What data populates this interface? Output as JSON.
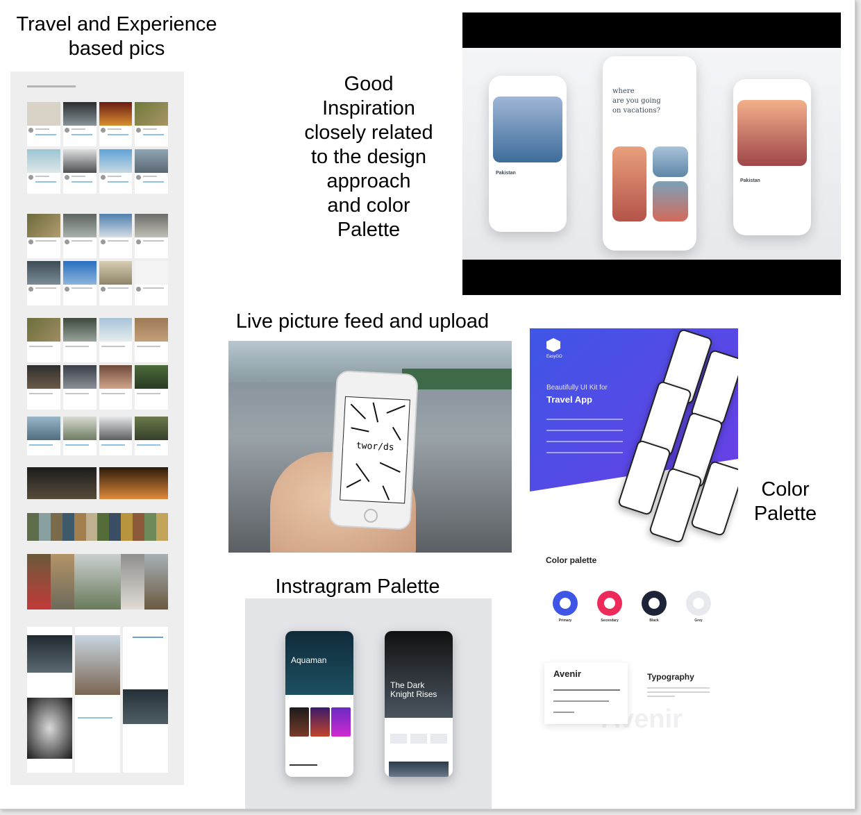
{
  "captions": {
    "travel_line1": "Travel and Experience",
    "travel_line2": "based pics",
    "good_inspiration": [
      "Good",
      "Inspiration",
      "closely related",
      "to the design",
      "approach",
      "and color",
      "Palette"
    ],
    "live_feed": "Live picture feed and upload",
    "color_palette_line1": "Color",
    "color_palette_line2": "Palette",
    "instagram_palette": "Instragram Palette"
  },
  "inspiration_mockup": {
    "question": [
      "where",
      "are you going",
      "on vacations?"
    ],
    "place": "Pakistan"
  },
  "live_photo": {
    "screen_text": "twor/ds"
  },
  "travel_kit": {
    "brand": "EasyGO",
    "tagline": "Beautifully UI Kit for",
    "headline": "Travel App",
    "accent": "#3e56e6",
    "palette_heading": "Color palette",
    "swatches": [
      {
        "name": "Primary",
        "color": "#3e56e6"
      },
      {
        "name": "Secondary",
        "color": "#ee2a5a"
      },
      {
        "name": "Black",
        "color": "#1e2437"
      },
      {
        "name": "Grey",
        "color": "#e8e9ef"
      }
    ],
    "font_name": "Avenir",
    "typography_heading": "Typography",
    "ghost_text": "Avenir"
  },
  "instagram_mockup": {
    "left_title": [
      "Aquaman"
    ],
    "right_title": [
      "The Dark",
      "Knight Rises"
    ]
  }
}
